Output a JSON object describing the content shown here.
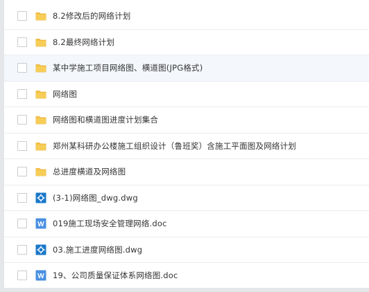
{
  "files": [
    {
      "name": "8.2修改后的网络计划",
      "icon": "folder-icon",
      "type": "folder"
    },
    {
      "name": "8.2最终网络计划",
      "icon": "folder-icon",
      "type": "folder"
    },
    {
      "name": "某中学施工项目网络图、横道图(JPG格式)",
      "icon": "folder-icon",
      "type": "folder"
    },
    {
      "name": "网络图",
      "icon": "folder-icon",
      "type": "folder"
    },
    {
      "name": "网络图和横道图进度计划集合",
      "icon": "folder-icon",
      "type": "folder"
    },
    {
      "name": "郑州某科研办公楼施工组织设计（鲁班奖）含施工平面图及网络计划",
      "icon": "folder-icon",
      "type": "folder"
    },
    {
      "name": "总进度横道及网络图",
      "icon": "folder-icon",
      "type": "folder"
    },
    {
      "name": "(3-1)网络图_dwg.dwg",
      "icon": "dwg-file-icon",
      "type": "dwg"
    },
    {
      "name": "019施工现场安全管理网络.doc",
      "icon": "word-doc-icon",
      "type": "doc"
    },
    {
      "name": "03.施工进度网络图.dwg",
      "icon": "dwg-file-icon",
      "type": "dwg"
    },
    {
      "name": "19、公司质量保证体系网络图.doc",
      "icon": "word-doc-icon",
      "type": "doc"
    }
  ],
  "selected_index": 2,
  "colors": {
    "folder": "#f5c344",
    "folder_dark": "#e5ad2a",
    "dwg": "#1a78c9",
    "word": "#4a90e2",
    "selected_bg": "#f4f7fb",
    "border": "#e9ebef"
  }
}
